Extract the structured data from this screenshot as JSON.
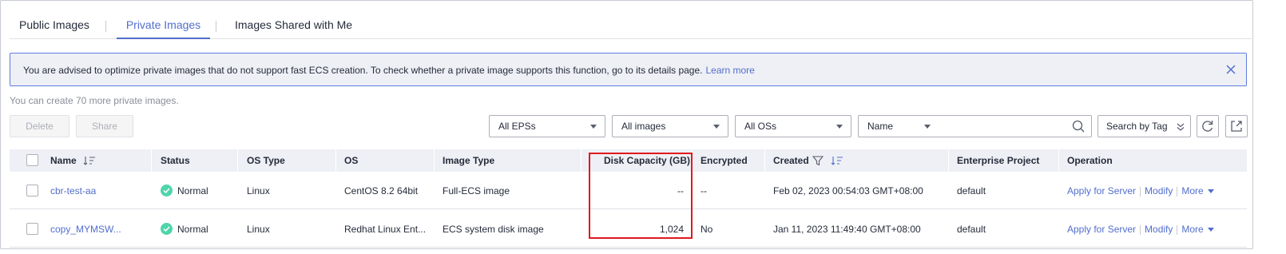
{
  "tabs": [
    {
      "label": "Public Images",
      "active": false
    },
    {
      "label": "Private Images",
      "active": true
    },
    {
      "label": "Images Shared with Me",
      "active": false
    }
  ],
  "notice": {
    "text": "You are advised to optimize private images that do not support fast ECS creation. To check whether a private image supports this function, go to its details page.",
    "link": "Learn more"
  },
  "quota_text": "You can create 70 more private images.",
  "toolbar": {
    "delete_label": "Delete",
    "share_label": "Share",
    "eps_filter": "All EPSs",
    "image_filter": "All images",
    "os_filter": "All OSs",
    "search_attr": "Name",
    "search_value": "",
    "tag_search_label": "Search by Tag"
  },
  "table": {
    "columns": [
      "Name",
      "Status",
      "OS Type",
      "OS",
      "Image Type",
      "Disk Capacity (GB)",
      "Encrypted",
      "Created",
      "Enterprise Project",
      "Operation"
    ],
    "rows": [
      {
        "name": "cbr-test-aa",
        "status": "Normal",
        "os_type": "Linux",
        "os": "CentOS 8.2 64bit",
        "image_type": "Full-ECS image",
        "disk_capacity": "--",
        "encrypted": "--",
        "created": "Feb 02, 2023 00:54:03 GMT+08:00",
        "enterprise_project": "default",
        "ops": [
          "Apply for Server",
          "Modify",
          "More"
        ]
      },
      {
        "name": "copy_MYMSW...",
        "status": "Normal",
        "os_type": "Linux",
        "os": "Redhat Linux Ent...",
        "image_type": "ECS system disk image",
        "disk_capacity": "1,024",
        "encrypted": "No",
        "created": "Jan 11, 2023 11:49:40 GMT+08:00",
        "enterprise_project": "default",
        "ops": [
          "Apply for Server",
          "Modify",
          "More"
        ]
      }
    ]
  },
  "colors": {
    "accent": "#526ecc",
    "status_normal": "#50d4ab",
    "highlight": "#e0191e",
    "notice_bg": "#eef0f5",
    "notice_border": "#5e7ce0"
  }
}
